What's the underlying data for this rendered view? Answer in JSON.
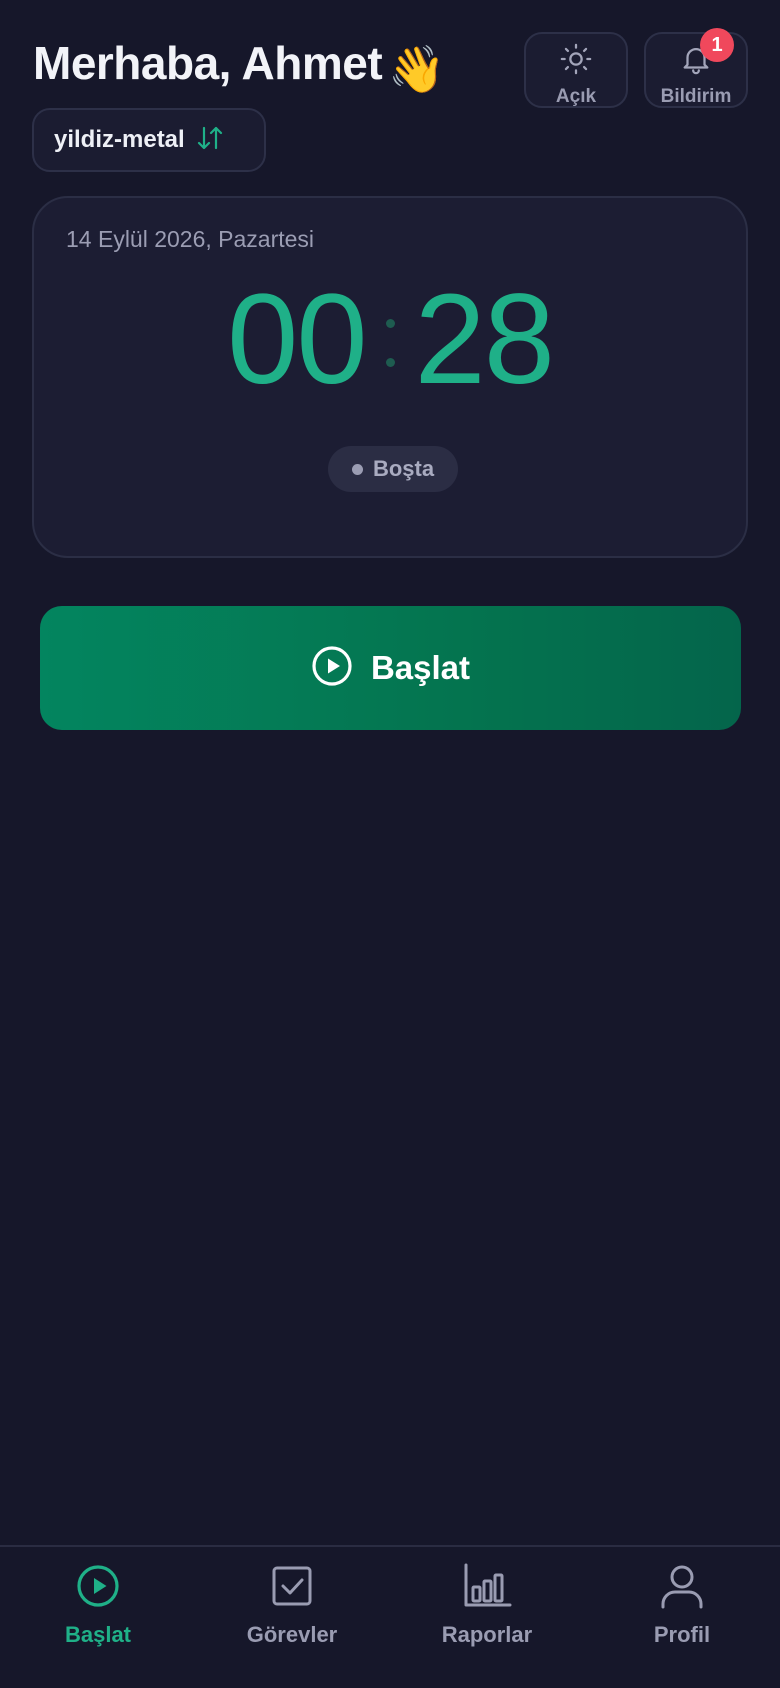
{
  "header": {
    "greeting": "Merhaba, Ahmet",
    "wave_emoji": "👋",
    "light_label": "Açık",
    "notification_label": "Bildirim",
    "notification_count": "1",
    "workspace": "yildiz-metal"
  },
  "timer": {
    "date": "14 Eylül 2026, Pazartesi",
    "hours": "00",
    "minutes": "28",
    "status": "Boşta"
  },
  "start_button": {
    "label": "Başlat"
  },
  "nav": {
    "items": [
      {
        "label": "Başlat",
        "icon": "play-circle-icon",
        "active": true
      },
      {
        "label": "Görevler",
        "icon": "checkbox-icon",
        "active": false
      },
      {
        "label": "Raporlar",
        "icon": "bar-chart-icon",
        "active": false
      },
      {
        "label": "Profil",
        "icon": "user-icon",
        "active": false
      }
    ]
  },
  "colors": {
    "background": "#16172a",
    "card": "#1c1d33",
    "accent": "#1fb088",
    "start_button": "#03855f",
    "badge": "#f0485c",
    "muted": "#9a9cb2"
  }
}
